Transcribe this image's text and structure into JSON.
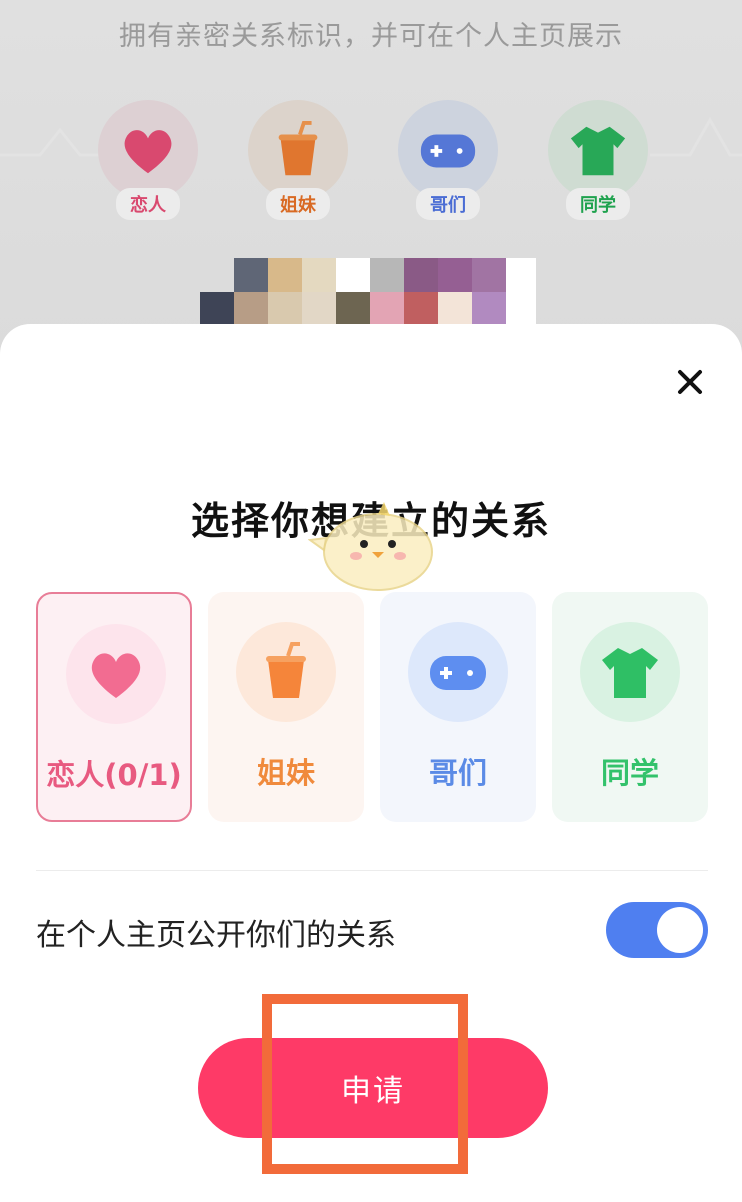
{
  "background": {
    "subtitle": "拥有亲密关系标识，并可在个人主页展示",
    "badges": [
      {
        "label": "恋人",
        "icon": "heart-icon",
        "color": "#e8325f"
      },
      {
        "label": "姐妹",
        "icon": "cup-icon",
        "color": "#e86a24"
      },
      {
        "label": "哥们",
        "icon": "gamepad-icon",
        "color": "#4a6cd4"
      },
      {
        "label": "同学",
        "icon": "shirt-icon",
        "color": "#1fa24e"
      }
    ]
  },
  "dialog": {
    "close_icon": "close-icon",
    "title": "选择你想建立的关系",
    "options": [
      {
        "label": "恋人(0/1)",
        "icon": "heart-icon",
        "color": "#e85a80",
        "selected": true
      },
      {
        "label": "姐妹",
        "icon": "cup-icon",
        "color": "#f08a3c",
        "selected": false
      },
      {
        "label": "哥们",
        "icon": "gamepad-icon",
        "color": "#5b8be6",
        "selected": false
      },
      {
        "label": "同学",
        "icon": "shirt-icon",
        "color": "#33c26b",
        "selected": false
      }
    ],
    "toggle_label": "在个人主页公开你们的关系",
    "toggle_on": true,
    "apply_label": "申请"
  },
  "colors": {
    "accent": "#fe3a67",
    "toggle": "#4f7ff0",
    "highlight": "#f26b3a"
  }
}
